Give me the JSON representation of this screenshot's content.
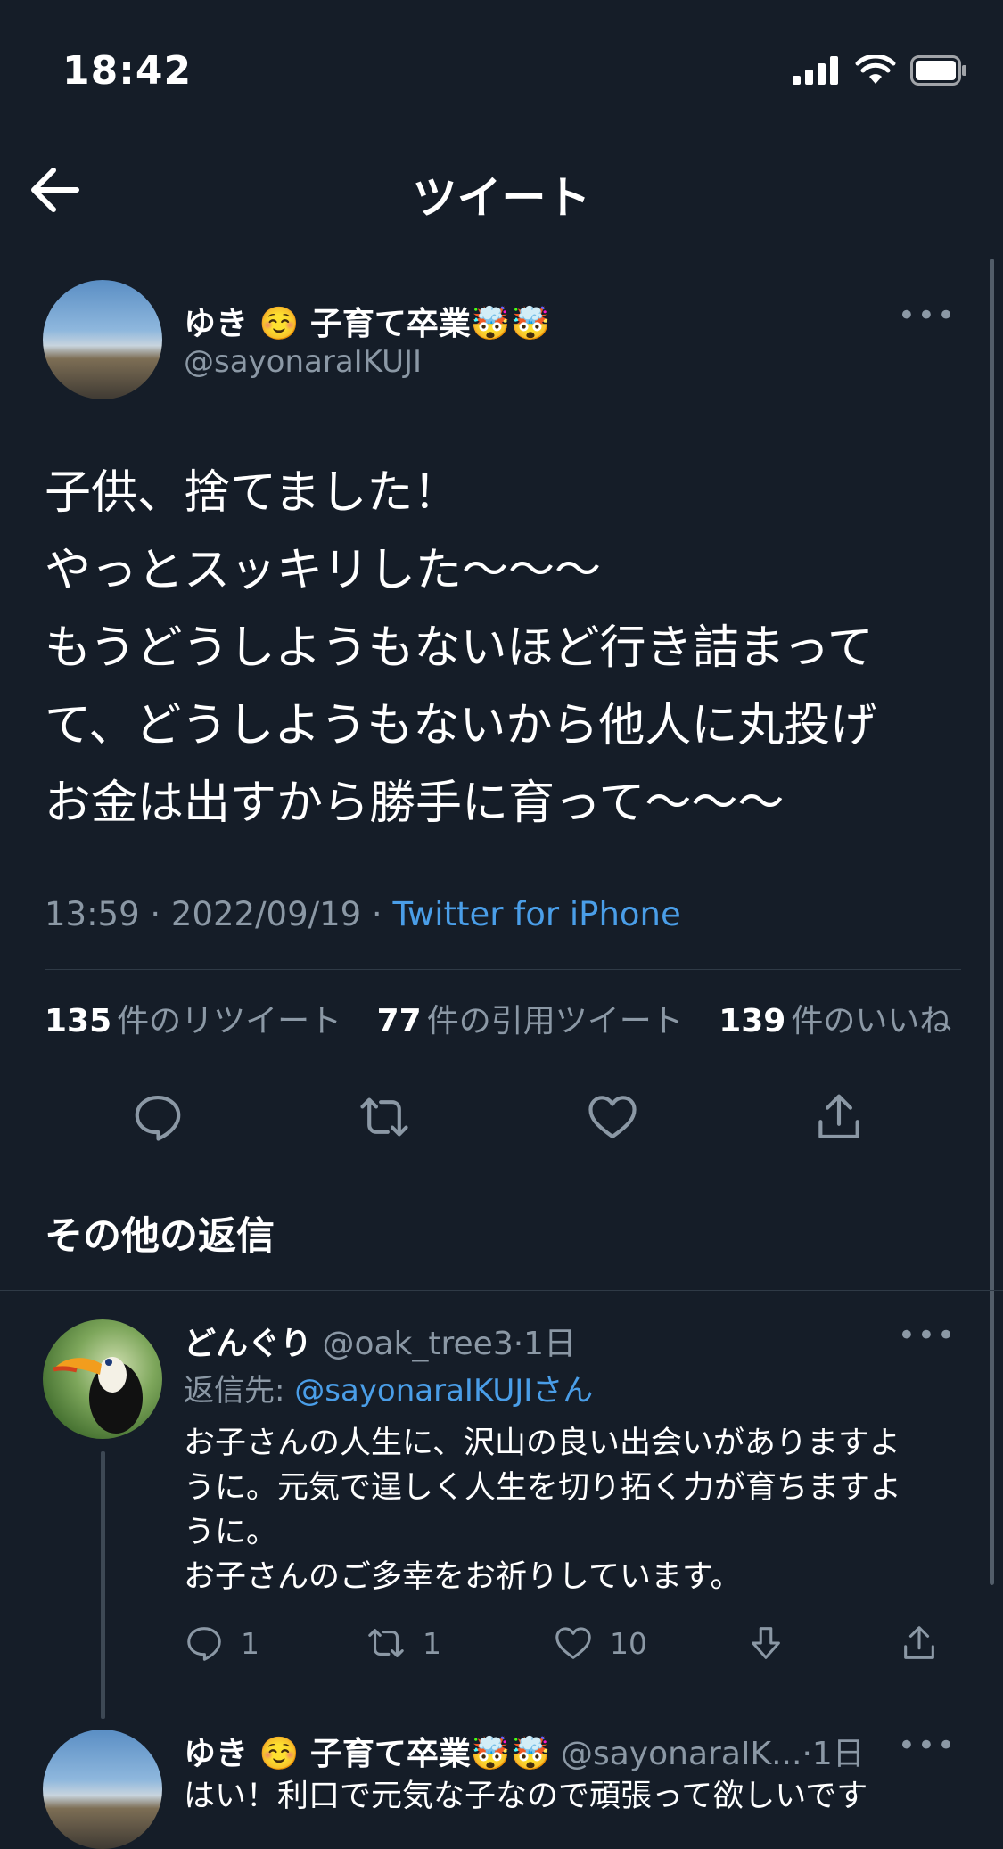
{
  "status_bar": {
    "time": "18:42"
  },
  "nav": {
    "title": "ツイート"
  },
  "tweet": {
    "author_name": "ゆき ☺️ 子育て卒業🤯🤯",
    "author_handle": "@sayonaraIKUJI",
    "more": "•••",
    "body_lines": [
      "子供、捨てました！",
      "やっとスッキリした〜〜〜",
      "もうどうしようもないほど行き詰まって",
      "て、どうしようもないから他人に丸投げ",
      "お金は出すから勝手に育って〜〜〜"
    ],
    "time": "13:59 · 2022/09/19 · ",
    "client": "Twitter for iPhone",
    "stats": {
      "retweets_num": "135",
      "retweets_label": "件のリツイート",
      "quotes_num": "77",
      "quotes_label": "件の引用ツイート",
      "likes_num": "139",
      "likes_label": "件のいいね"
    }
  },
  "section": {
    "title": "その他の返信"
  },
  "replies": [
    {
      "name": "どんぐり",
      "handle": "@oak_tree3",
      "age": "·1日",
      "more": "•••",
      "reply_to_label": "返信先: ",
      "reply_to_handle": "@sayonaraIKUJI",
      "reply_to_suffix": "さん",
      "body_lines": [
        "お子さんの人生に、沢山の良い出会いがありますよ",
        "うに。元気で逞しく人生を切り拓く力が育ちますよ",
        "うに。",
        "お子さんのご多幸をお祈りしています。"
      ],
      "reply_count": "1",
      "retweet_count": "1",
      "like_count": "10"
    },
    {
      "name": "ゆき ☺️ 子育て卒業🤯🤯",
      "handle": "@sayonaraIK...",
      "age": "·1日",
      "more": "•••",
      "body": "はい！利口で元気な子なので頑張って欲しいです"
    }
  ],
  "colors": {
    "background": "#151d28",
    "accent": "#4a9ee8",
    "muted": "#8b98a5"
  }
}
